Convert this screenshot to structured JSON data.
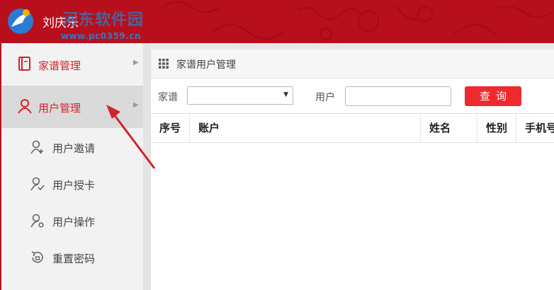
{
  "header": {
    "user_name": "刘庆乐",
    "watermark_text": "河东软件园",
    "watermark_url": "www.pc0359.cn",
    "bg_color": "#b80f1c"
  },
  "sidebar": {
    "menu": [
      {
        "label": "家谱管理",
        "icon": "book-icon"
      },
      {
        "label": "用户管理",
        "icon": "user-icon"
      }
    ],
    "sub_items": [
      {
        "label": "用户邀请",
        "icon": "user-add-icon"
      },
      {
        "label": "用户授卡",
        "icon": "user-check-icon"
      },
      {
        "label": "用户操作",
        "icon": "user-settings-icon"
      },
      {
        "label": "重置密码",
        "icon": "reset-password-icon"
      }
    ]
  },
  "panel": {
    "title": "家谱用户管理",
    "genealogy_label": "家谱",
    "genealogy_value": "",
    "user_label": "用户",
    "user_value": "",
    "query_button": "查询"
  },
  "table": {
    "columns": [
      "序号",
      "账户",
      "姓名",
      "性别",
      "手机号"
    ]
  },
  "colors": {
    "accent": "#d4212a",
    "button": "#ee2a2f"
  }
}
